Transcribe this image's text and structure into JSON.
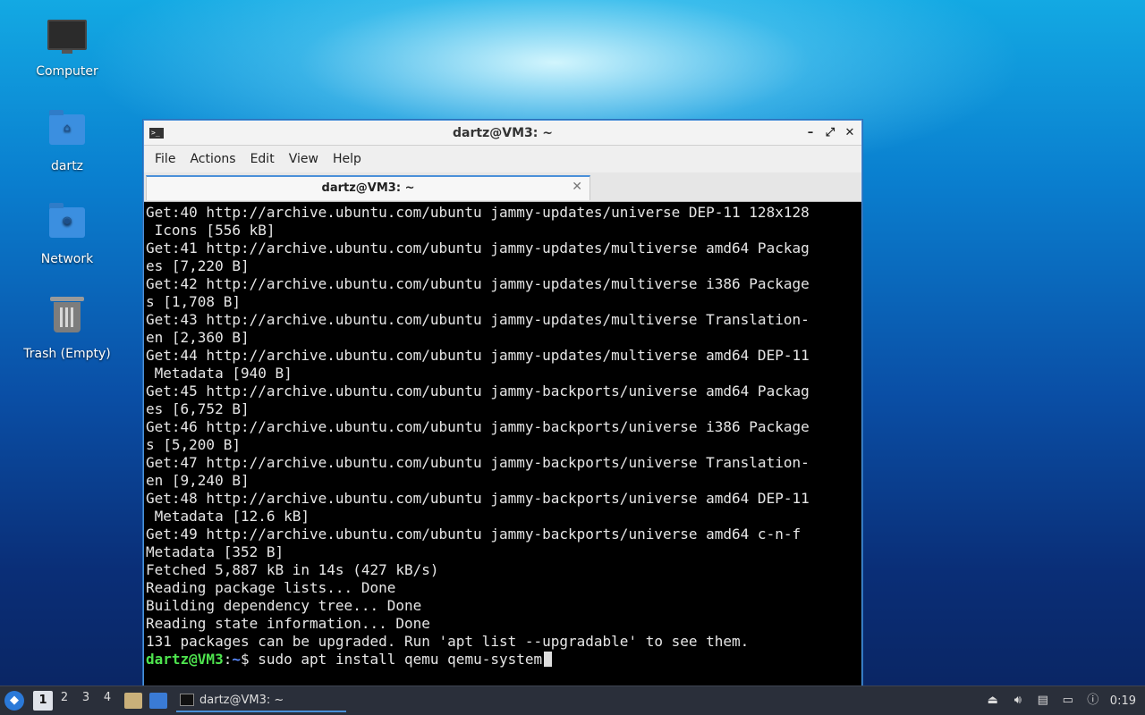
{
  "desktop": {
    "icons": [
      {
        "label": "Computer"
      },
      {
        "label": "dartz"
      },
      {
        "label": "Network"
      },
      {
        "label": "Trash (Empty)"
      }
    ]
  },
  "window": {
    "title": "dartz@VM3: ~",
    "menu": [
      "File",
      "Actions",
      "Edit",
      "View",
      "Help"
    ],
    "tab_label": "dartz@VM3: ~",
    "controls": {
      "minimize": "–",
      "maximize": "⤢",
      "close": "✕"
    }
  },
  "terminal": {
    "lines": [
      "Get:40 http://archive.ubuntu.com/ubuntu jammy-updates/universe DEP-11 128x128",
      " Icons [556 kB]",
      "Get:41 http://archive.ubuntu.com/ubuntu jammy-updates/multiverse amd64 Packag",
      "es [7,220 B]",
      "Get:42 http://archive.ubuntu.com/ubuntu jammy-updates/multiverse i386 Package",
      "s [1,708 B]",
      "Get:43 http://archive.ubuntu.com/ubuntu jammy-updates/multiverse Translation-",
      "en [2,360 B]",
      "Get:44 http://archive.ubuntu.com/ubuntu jammy-updates/multiverse amd64 DEP-11",
      " Metadata [940 B]",
      "Get:45 http://archive.ubuntu.com/ubuntu jammy-backports/universe amd64 Packag",
      "es [6,752 B]",
      "Get:46 http://archive.ubuntu.com/ubuntu jammy-backports/universe i386 Package",
      "s [5,200 B]",
      "Get:47 http://archive.ubuntu.com/ubuntu jammy-backports/universe Translation-",
      "en [9,240 B]",
      "Get:48 http://archive.ubuntu.com/ubuntu jammy-backports/universe amd64 DEP-11",
      " Metadata [12.6 kB]",
      "Get:49 http://archive.ubuntu.com/ubuntu jammy-backports/universe amd64 c-n-f",
      "Metadata [352 B]",
      "Fetched 5,887 kB in 14s (427 kB/s)",
      "Reading package lists... Done",
      "Building dependency tree... Done",
      "Reading state information... Done",
      "131 packages can be upgraded. Run 'apt list --upgradable' to see them."
    ],
    "prompt_user": "dartz@VM3",
    "prompt_sep": ":",
    "prompt_path": "~",
    "prompt_symbol": "$ ",
    "command": "sudo apt install qemu qemu-system"
  },
  "taskbar": {
    "workspaces": [
      "1",
      "2",
      "3",
      "4"
    ],
    "active_workspace": "1",
    "task_label": "dartz@VM3: ~",
    "clock": "0:19"
  }
}
